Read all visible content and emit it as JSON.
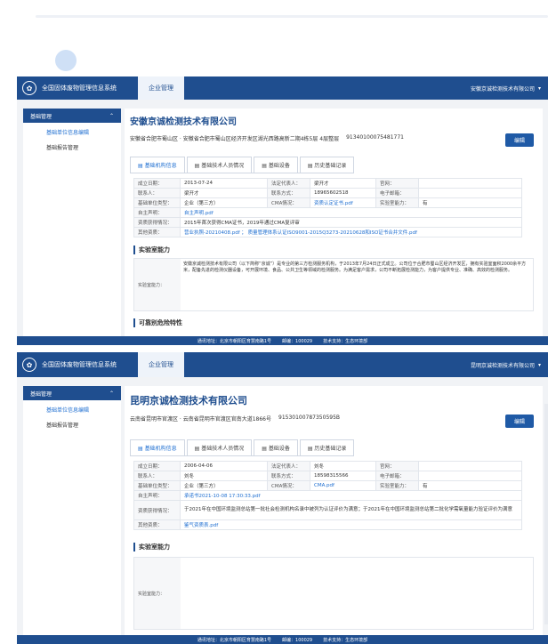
{
  "header": {
    "system_name": "全国固体废物管理信息系统",
    "nav_tab": "企业管理",
    "logo_glyph": "✿",
    "menu_caret": "▾"
  },
  "sidebar": {
    "heading": "基础管理",
    "items": [
      "基础单位信息编辑",
      "基础报告管理"
    ],
    "collapse_glyph": "⌃"
  },
  "tabs": [
    "基础机构信息",
    "基础技术人员情况",
    "基础设备",
    "历史基础记录"
  ],
  "tab_icon": "▤",
  "edit_label": "编辑",
  "lab_section": "实验室能力",
  "risk_section": "可靠别危险特性",
  "footer": {
    "address": "通讯地址：北京市朝阳区育慧南路1号",
    "postcode": "邮编：100029",
    "tech": "技术支持：生态环境部"
  },
  "screens": [
    {
      "company_menu": "安徽京诚检测技术有限公司",
      "company": "安徽京诚检测技术有限公司",
      "address": "安徽省合肥市蜀山区 · 安徽省合肥市蜀山区经济开发区湖光西路高新二期4栋5层 4层整层",
      "credit_code": "91340100075481771",
      "fields": {
        "est_date_lbl": "成立日期：",
        "est_date": "2013-07-24",
        "legal_lbl": "法定代表人：",
        "legal": "梁开才",
        "site_lbl": "官网：",
        "site": "",
        "contact_lbl": "联系人：",
        "contact": "梁开才",
        "phone_lbl": "联系方式：",
        "phone": "18965602518",
        "email_lbl": "电子邮箱：",
        "email": "",
        "type_lbl": "基础单位类型：",
        "type": "企业（第三方）",
        "cma_lbl": "CMA情况：",
        "cma": "资质认定证书.pdf",
        "lab_lbl": "实验室能力：",
        "lab": "有",
        "self_lbl": "自主声明：",
        "self": "自主声明.pdf",
        "qual_lbl": "资质获得情况：",
        "qual": "2015年首次获得CMA证书，2019年通过CMA复评审",
        "other_lbl": "其他资质：",
        "other": "营业执照-20210408.pdf ； 质量管理体系认证ISO9001-2015Q3273-20210628和ISO证书合并文件.pdf"
      },
      "lab_label": "实验室能力：",
      "lab_text": "安徽京诚检测技术有限公司（以下简称“京诚”）是专业的第三方检测服务机构，于2013年7月24日正式成立。公司位于合肥市蜀山区经济开发区，拥有实验室面积2000余平方米，配备先进的检测仪器设备，可开展环境、食品、公共卫生等领域的检测服务。为满足客户需求，公司不断拓展检测能力，为客户提供专业、准确、高效的检测服务。"
    },
    {
      "company_menu": "昆明京诚检测技术有限公司",
      "company": "昆明京诚检测技术有限公司",
      "address": "云南省昆明市官渡区 · 云南省昆明市官渡区官南大道1866号",
      "credit_code": "91530100787350595B",
      "fields": {
        "est_date_lbl": "成立日期：",
        "est_date": "2006-04-06",
        "legal_lbl": "法定代表人：",
        "legal": "刘冬",
        "site_lbl": "官网：",
        "site": "",
        "contact_lbl": "联系人：",
        "contact": "刘冬",
        "phone_lbl": "联系方式：",
        "phone": "18598315566",
        "email_lbl": "电子邮箱：",
        "email": "",
        "type_lbl": "基础单位类型：",
        "type": "企业（第三方）",
        "cma_lbl": "CMA情况：",
        "cma": "CMA.pdf",
        "lab_lbl": "实验室能力：",
        "lab": "有",
        "self_lbl": "自主声明：",
        "self": "承诺书2021-10-08 17:30:33.pdf",
        "qual_lbl": "资质获得情况：",
        "qual": "于2021年在中国环境监测总站第一批社会检测机构名录中被列为认证评价为满意；于2021年在中国环境监测总站第二批化学需氧量能力验证评价为满意",
        "other_lbl": "其他资质：",
        "other": "鉴气资质表.pdf"
      },
      "lab_label": "实验室能力：",
      "lab_text": ""
    }
  ]
}
